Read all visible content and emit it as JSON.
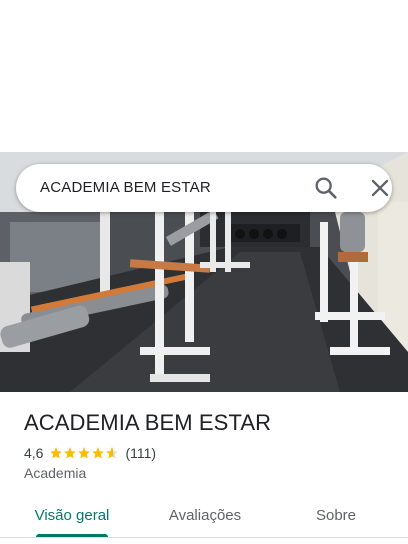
{
  "search": {
    "query": "ACADEMIA BEM ESTAR"
  },
  "icons": {
    "search": "search-icon",
    "close": "close-icon",
    "star": "star-icon"
  },
  "place": {
    "name": "ACADEMIA BEM ESTAR",
    "rating": "4,6",
    "stars": 4.6,
    "review_count": "(111)",
    "category": "Academia"
  },
  "tabs": [
    {
      "label": "Visão geral",
      "active": true
    },
    {
      "label": "Avaliações",
      "active": false
    },
    {
      "label": "Sobre",
      "active": false
    }
  ],
  "colors": {
    "accent": "#00796b",
    "star": "#fbbc04",
    "text_primary": "#202124",
    "text_secondary": "#5f6368"
  }
}
